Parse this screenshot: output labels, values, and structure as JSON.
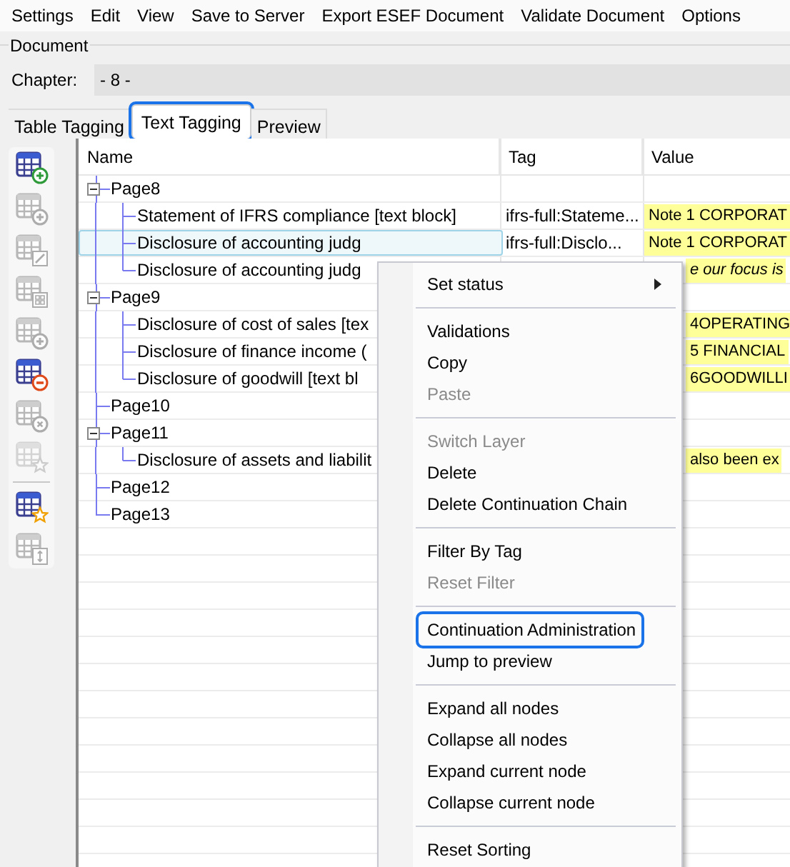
{
  "menu_bar": [
    "Settings",
    "Edit",
    "View",
    "Save to Server",
    "Export ESEF Document",
    "Validate Document",
    "Options"
  ],
  "document_group": {
    "title": "Document",
    "chapter_label": "Chapter:",
    "chapter_value": "- 8 -"
  },
  "tabs": [
    {
      "label": "Table Tagging",
      "selected": false,
      "highlighted": false
    },
    {
      "label": "Text Tagging",
      "selected": true,
      "highlighted": true
    },
    {
      "label": "Preview",
      "selected": false,
      "highlighted": false
    }
  ],
  "toolbar": [
    {
      "kind": "add",
      "disabled": false
    },
    {
      "kind": "add",
      "disabled": true
    },
    {
      "kind": "edit",
      "disabled": true
    },
    {
      "kind": "grid",
      "disabled": true
    },
    {
      "kind": "add",
      "disabled": true
    },
    {
      "kind": "remove",
      "disabled": false
    },
    {
      "kind": "clear",
      "disabled": true
    },
    {
      "kind": "star",
      "disabled": true
    },
    {
      "kind": "separator"
    },
    {
      "kind": "star",
      "disabled": false
    },
    {
      "kind": "resize",
      "disabled": true
    }
  ],
  "table": {
    "columns": [
      "Name",
      "Tag",
      "Value"
    ],
    "rows": [
      {
        "name": "Page8",
        "expanded": true,
        "children": [
          {
            "name": "Statement of IFRS compliance [text block]",
            "tag": "ifrs-full:Stateme...",
            "value": "Note 1 CORPORAT",
            "selected": false
          },
          {
            "name": "Disclosure of accounting judg",
            "tag": "ifrs-full:Disclo...",
            "value": "Note 1 CORPORAT",
            "selected": true
          },
          {
            "name": "Disclosure of accounting judg",
            "value": "e our focus is",
            "italic": true,
            "selected": false
          }
        ]
      },
      {
        "name": "Page9",
        "expanded": true,
        "children": [
          {
            "name": "Disclosure of cost of sales [tex",
            "value": "4OPERATING",
            "selected": false
          },
          {
            "name": "Disclosure of finance income (",
            "value": "5 FINANCIAL",
            "selected": false
          },
          {
            "name": "Disclosure of goodwill [text bl",
            "value": "6GOODWILLI",
            "selected": false
          }
        ]
      },
      {
        "name": "Page10"
      },
      {
        "name": "Page11",
        "expanded": true,
        "children": [
          {
            "name": "Disclosure of assets and liabilit",
            "value": "also been ex",
            "selected": false
          }
        ]
      },
      {
        "name": "Page12"
      },
      {
        "name": "Page13"
      }
    ]
  },
  "context_menu": [
    {
      "kind": "item",
      "label": "Set status",
      "disabled": false,
      "submenu": true,
      "highlighted": false
    },
    {
      "kind": "separator"
    },
    {
      "kind": "item",
      "label": "Validations",
      "disabled": false,
      "highlighted": false
    },
    {
      "kind": "item",
      "label": "Copy",
      "disabled": false,
      "highlighted": false
    },
    {
      "kind": "item",
      "label": "Paste",
      "disabled": true,
      "highlighted": false
    },
    {
      "kind": "separator"
    },
    {
      "kind": "item",
      "label": "Switch Layer",
      "disabled": true,
      "highlighted": false
    },
    {
      "kind": "item",
      "label": "Delete",
      "disabled": false,
      "highlighted": false
    },
    {
      "kind": "item",
      "label": "Delete Continuation Chain",
      "disabled": false,
      "highlighted": false
    },
    {
      "kind": "separator"
    },
    {
      "kind": "item",
      "label": "Filter By Tag",
      "disabled": false,
      "highlighted": false
    },
    {
      "kind": "item",
      "label": "Reset Filter",
      "disabled": true,
      "highlighted": false
    },
    {
      "kind": "separator"
    },
    {
      "kind": "item",
      "label": "Continuation Administration",
      "disabled": false,
      "highlighted": true
    },
    {
      "kind": "item",
      "label": "Jump to preview",
      "disabled": false,
      "highlighted": false
    },
    {
      "kind": "separator"
    },
    {
      "kind": "item",
      "label": "Expand all nodes",
      "disabled": false,
      "highlighted": false
    },
    {
      "kind": "item",
      "label": "Collapse all nodes",
      "disabled": false,
      "highlighted": false
    },
    {
      "kind": "item",
      "label": "Expand current node",
      "disabled": false,
      "highlighted": false
    },
    {
      "kind": "item",
      "label": "Collapse current node",
      "disabled": false,
      "highlighted": false
    },
    {
      "kind": "separator"
    },
    {
      "kind": "item",
      "label": "Reset Sorting",
      "disabled": false,
      "highlighted": false
    }
  ]
}
